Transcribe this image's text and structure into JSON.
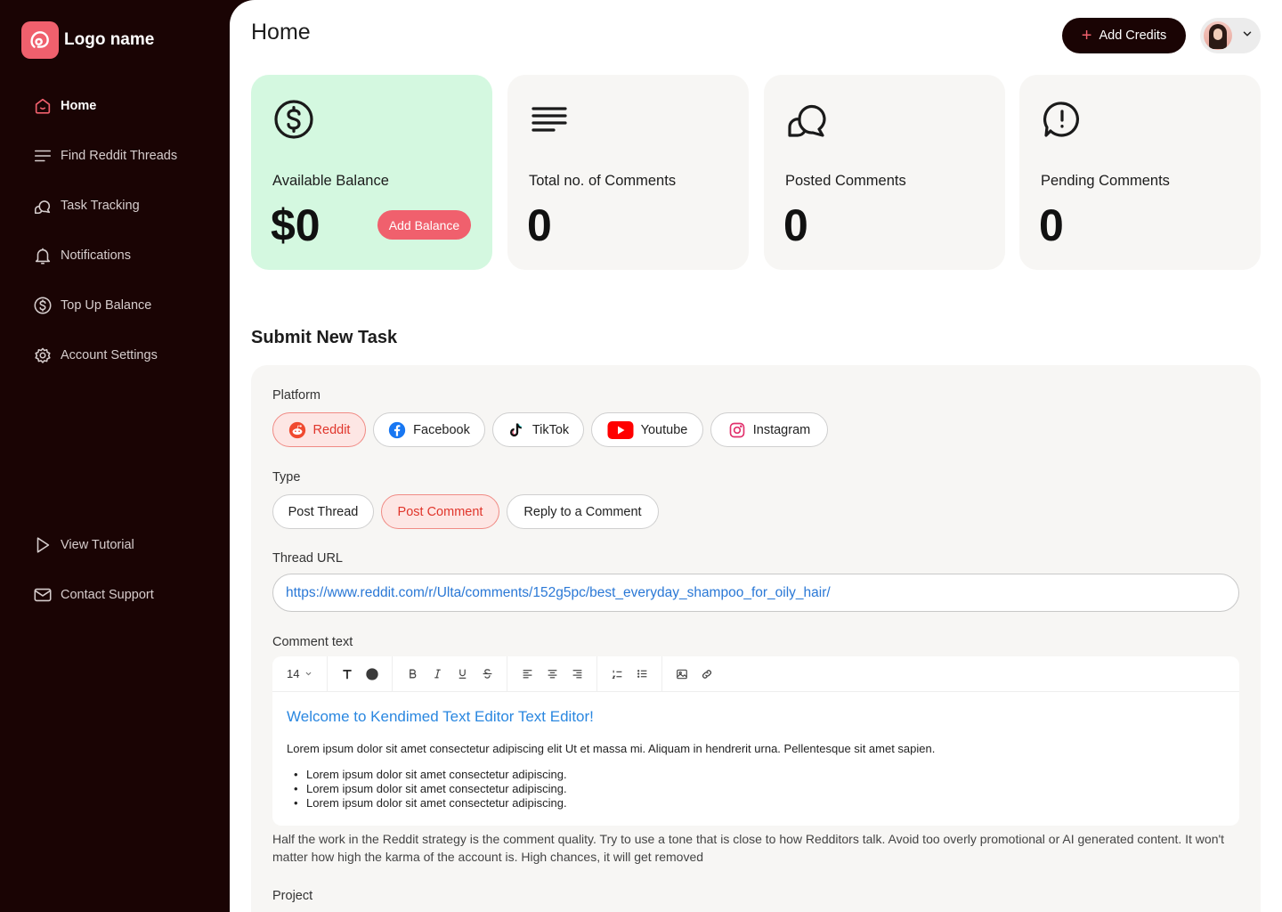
{
  "brand": {
    "name": "Logo name",
    "accent": "#f0606d",
    "dark": "#1a0404"
  },
  "sidebar": {
    "items": [
      {
        "label": "Home",
        "icon": "home-icon",
        "active": true
      },
      {
        "label": "Find Reddit Threads",
        "icon": "lines-icon"
      },
      {
        "label": "Task Tracking",
        "icon": "chat-bubbles-icon"
      },
      {
        "label": "Notifications",
        "icon": "bell-icon"
      },
      {
        "label": "Top Up Balance",
        "icon": "dollar-circle-icon"
      },
      {
        "label": "Account Settings",
        "icon": "gear-icon"
      }
    ],
    "bottom_items": [
      {
        "label": "View Tutorial",
        "icon": "play-icon"
      },
      {
        "label": "Contact Support",
        "icon": "mail-icon"
      }
    ]
  },
  "header": {
    "title": "Home",
    "add_credits_label": "Add Credits"
  },
  "stats": [
    {
      "label": "Available Balance",
      "value": "$0",
      "action_label": "Add Balance",
      "icon": "dollar-circle-icon"
    },
    {
      "label": "Total no. of Comments",
      "value": "0",
      "icon": "text-lines-icon"
    },
    {
      "label": "Posted Comments",
      "value": "0",
      "icon": "chat-bubbles-icon"
    },
    {
      "label": "Pending Comments",
      "value": "0",
      "icon": "alert-bubble-icon"
    }
  ],
  "form": {
    "section_title": "Submit New Task",
    "platform_label": "Platform",
    "platforms": [
      {
        "label": "Reddit",
        "icon": "reddit-icon",
        "selected": true
      },
      {
        "label": "Facebook",
        "icon": "facebook-icon"
      },
      {
        "label": "TikTok",
        "icon": "tiktok-icon"
      },
      {
        "label": "Youtube",
        "icon": "youtube-icon"
      },
      {
        "label": "Instagram",
        "icon": "instagram-icon"
      }
    ],
    "type_label": "Type",
    "types": [
      {
        "label": "Post Thread"
      },
      {
        "label": "Post Comment",
        "selected": true
      },
      {
        "label": "Reply to a Comment"
      }
    ],
    "thread_url_label": "Thread URL",
    "thread_url_value": "https://www.reddit.com/r/Ulta/comments/152g5pc/best_everyday_shampoo_for_oily_hair/",
    "comment_text_label": "Comment text",
    "editor": {
      "font_size": "14",
      "heading": "Welcome to Kendimed Text Editor Text Editor!",
      "paragraph": "Lorem ipsum dolor sit amet consectetur adipiscing elit Ut et massa mi. Aliquam in hendrerit urna. Pellentesque sit amet sapien.",
      "bullets": [
        "Lorem ipsum dolor sit amet consectetur adipiscing.",
        "Lorem ipsum dolor sit amet consectetur adipiscing.",
        "Lorem ipsum dolor sit amet consectetur adipiscing."
      ]
    },
    "hint": "Half the work in the Reddit strategy is the comment quality. Try to use a tone that is close to how Redditors talk. Avoid too overly promotional or AI generated content. It won't matter how high the karma of the account is. High chances, it will get removed",
    "project_label": "Project"
  }
}
